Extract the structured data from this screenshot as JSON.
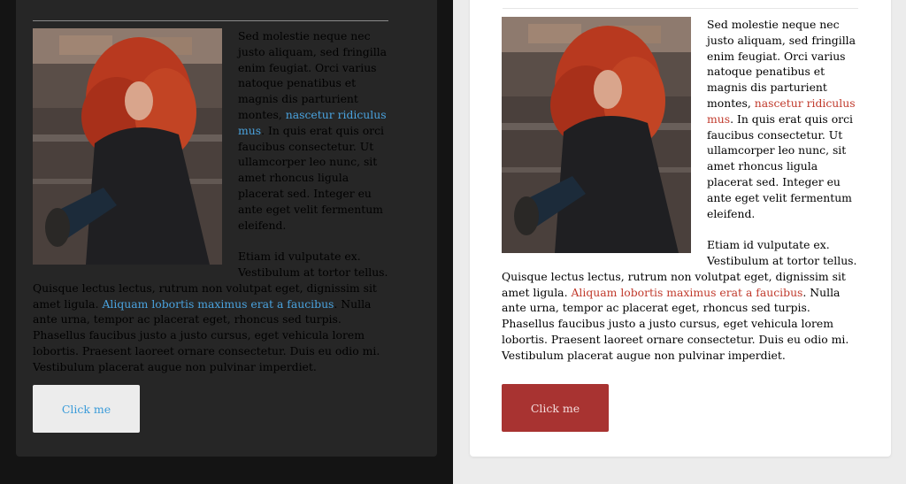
{
  "text": {
    "para1_a": "Sed molestie neque nec justo aliquam, sed fringilla enim feugiat. Orci varius natoque penatibus et magnis dis parturient montes, ",
    "link1": "nascetur ridiculus mus",
    "para1_b": ". In quis erat quis orci faucibus consectetur. Ut ullamcorper leo nunc, sit amet rhoncus ligula placerat sed. Integer eu ante eget velit fermentum eleifend.",
    "para2_a": "Etiam id vulputate ex. Vestibulum at tortor tellus. Quisque lectus lectus, rutrum non volutpat eget, dignissim sit amet ligula. ",
    "link2": "Aliquam lobortis maximus erat a faucibus",
    "para2_b": ". Nulla ante urna, tempor ac placerat eget, rhoncus sed turpis. Phasellus faucibus justo a justo cursus, eget vehicula lorem lobortis. Praesent laoreet ornare consectetur. Duis eu odio mi. Vestibulum placerat augue non pulvinar imperdiet."
  },
  "button": {
    "label": "Click me"
  },
  "themes": {
    "dark": {
      "background": "#141414",
      "card": "#262626",
      "text": "#eaeaea",
      "link": "#4aa3df",
      "button_bg": "#ececec",
      "button_text": "#3a9bd9"
    },
    "light": {
      "background": "#ececec",
      "card": "#ffffff",
      "text": "#333333",
      "link": "#c0392b",
      "button_bg": "#a83331",
      "button_text": "#f4dcdc"
    }
  },
  "image": {
    "subject": "woman-with-red-curly-hair-by-water-photo"
  }
}
